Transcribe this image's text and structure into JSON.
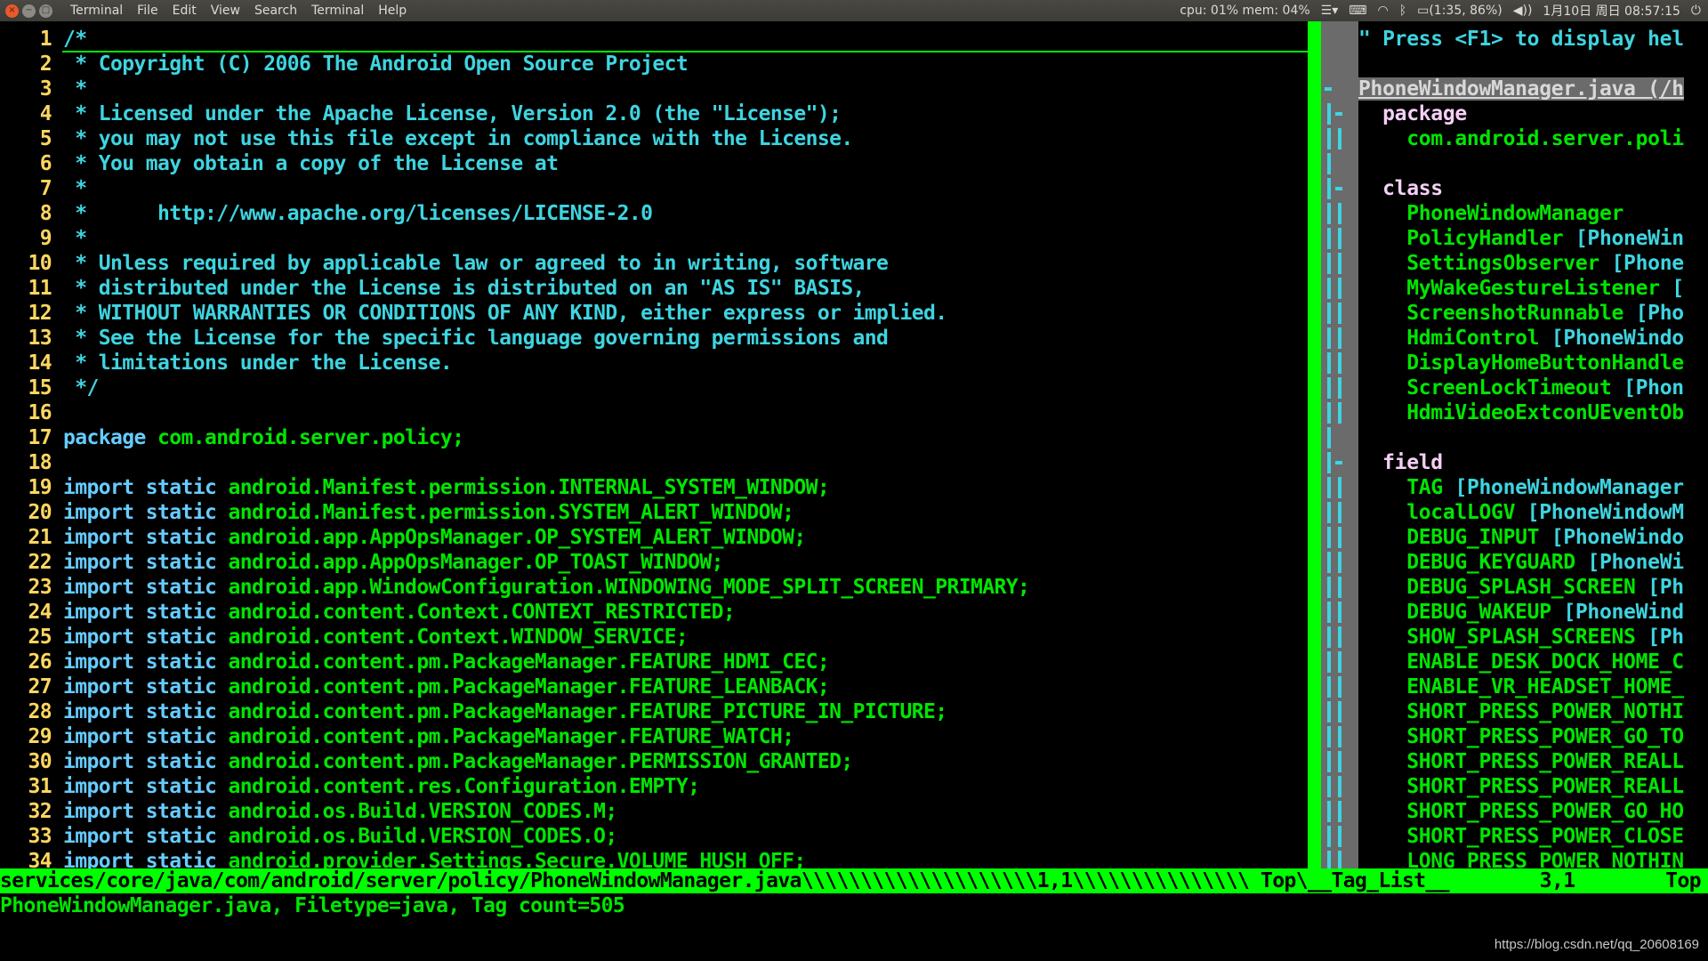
{
  "topbar": {
    "app_name": "Terminal",
    "menus": [
      "File",
      "Edit",
      "View",
      "Search",
      "Terminal",
      "Help"
    ],
    "window_buttons": {
      "close": "×",
      "minimize": "−",
      "maximize": "□"
    },
    "tray": {
      "sysmon": "cpu: 01% mem: 04%",
      "menu_icon": "☰▾",
      "keyboard_icon": "⌨",
      "wifi_icon": "◠",
      "bluetooth_icon": "ᛒ",
      "battery_icon": "▭",
      "battery": "(1:35, 86%)",
      "volume_icon": "◀))",
      "datetime": "1月10日 周日 08:57:15",
      "power_icon": "⏻"
    }
  },
  "editor": {
    "lines": [
      {
        "n": "1",
        "parts": [
          [
            "cmt",
            "/*"
          ]
        ]
      },
      {
        "n": "2",
        "parts": [
          [
            "cmt",
            " * Copyright (C) 2006 The Android Open Source Project"
          ]
        ]
      },
      {
        "n": "3",
        "parts": [
          [
            "cmt",
            " *"
          ]
        ]
      },
      {
        "n": "4",
        "parts": [
          [
            "cmt",
            " * Licensed under the Apache License, Version 2.0 (the \"License\");"
          ]
        ]
      },
      {
        "n": "5",
        "parts": [
          [
            "cmt",
            " * you may not use this file except in compliance with the License."
          ]
        ]
      },
      {
        "n": "6",
        "parts": [
          [
            "cmt",
            " * You may obtain a copy of the License at"
          ]
        ]
      },
      {
        "n": "7",
        "parts": [
          [
            "cmt",
            " *"
          ]
        ]
      },
      {
        "n": "8",
        "parts": [
          [
            "cmt",
            " *      http://www.apache.org/licenses/LICENSE-2.0"
          ]
        ]
      },
      {
        "n": "9",
        "parts": [
          [
            "cmt",
            " *"
          ]
        ]
      },
      {
        "n": "10",
        "parts": [
          [
            "cmt",
            " * Unless required by applicable law or agreed to in writing, software"
          ]
        ]
      },
      {
        "n": "11",
        "parts": [
          [
            "cmt",
            " * distributed under the License is distributed on an \"AS IS\" BASIS,"
          ]
        ]
      },
      {
        "n": "12",
        "parts": [
          [
            "cmt",
            " * WITHOUT WARRANTIES OR CONDITIONS OF ANY KIND, either express or implied."
          ]
        ]
      },
      {
        "n": "13",
        "parts": [
          [
            "cmt",
            " * See the License for the specific language governing permissions and"
          ]
        ]
      },
      {
        "n": "14",
        "parts": [
          [
            "cmt",
            " * limitations under the License."
          ]
        ]
      },
      {
        "n": "15",
        "parts": [
          [
            "cmt",
            " */"
          ]
        ]
      },
      {
        "n": "16",
        "parts": []
      },
      {
        "n": "17",
        "parts": [
          [
            "kw",
            "package "
          ],
          [
            "id",
            "com.android.server.policy;"
          ]
        ]
      },
      {
        "n": "18",
        "parts": []
      },
      {
        "n": "19",
        "parts": [
          [
            "kw",
            "import static "
          ],
          [
            "id",
            "android.Manifest.permission.INTERNAL_SYSTEM_WINDOW;"
          ]
        ]
      },
      {
        "n": "20",
        "parts": [
          [
            "kw",
            "import static "
          ],
          [
            "id",
            "android.Manifest.permission.SYSTEM_ALERT_WINDOW;"
          ]
        ]
      },
      {
        "n": "21",
        "parts": [
          [
            "kw",
            "import static "
          ],
          [
            "id",
            "android.app.AppOpsManager.OP_SYSTEM_ALERT_WINDOW;"
          ]
        ]
      },
      {
        "n": "22",
        "parts": [
          [
            "kw",
            "import static "
          ],
          [
            "id",
            "android.app.AppOpsManager.OP_TOAST_WINDOW;"
          ]
        ]
      },
      {
        "n": "23",
        "parts": [
          [
            "kw",
            "import static "
          ],
          [
            "id",
            "android.app.WindowConfiguration.WINDOWING_MODE_SPLIT_SCREEN_PRIMARY;"
          ]
        ]
      },
      {
        "n": "24",
        "parts": [
          [
            "kw",
            "import static "
          ],
          [
            "id",
            "android.content.Context.CONTEXT_RESTRICTED;"
          ]
        ]
      },
      {
        "n": "25",
        "parts": [
          [
            "kw",
            "import static "
          ],
          [
            "id",
            "android.content.Context.WINDOW_SERVICE;"
          ]
        ]
      },
      {
        "n": "26",
        "parts": [
          [
            "kw",
            "import static "
          ],
          [
            "id",
            "android.content.pm.PackageManager.FEATURE_HDMI_CEC;"
          ]
        ]
      },
      {
        "n": "27",
        "parts": [
          [
            "kw",
            "import static "
          ],
          [
            "id",
            "android.content.pm.PackageManager.FEATURE_LEANBACK;"
          ]
        ]
      },
      {
        "n": "28",
        "parts": [
          [
            "kw",
            "import static "
          ],
          [
            "id",
            "android.content.pm.PackageManager.FEATURE_PICTURE_IN_PICTURE;"
          ]
        ]
      },
      {
        "n": "29",
        "parts": [
          [
            "kw",
            "import static "
          ],
          [
            "id",
            "android.content.pm.PackageManager.FEATURE_WATCH;"
          ]
        ]
      },
      {
        "n": "30",
        "parts": [
          [
            "kw",
            "import static "
          ],
          [
            "id",
            "android.content.pm.PackageManager.PERMISSION_GRANTED;"
          ]
        ]
      },
      {
        "n": "31",
        "parts": [
          [
            "kw",
            "import static "
          ],
          [
            "id",
            "android.content.res.Configuration.EMPTY;"
          ]
        ]
      },
      {
        "n": "32",
        "parts": [
          [
            "kw",
            "import static "
          ],
          [
            "id",
            "android.os.Build.VERSION_CODES.M;"
          ]
        ]
      },
      {
        "n": "33",
        "parts": [
          [
            "kw",
            "import static "
          ],
          [
            "id",
            "android.os.Build.VERSION_CODES.O;"
          ]
        ]
      },
      {
        "n": "34",
        "parts": [
          [
            "kw",
            "import static "
          ],
          [
            "id",
            "android.provider.Settings.Secure.VOLUME_HUSH_OFF;"
          ]
        ]
      }
    ]
  },
  "taglist": {
    "lines": [
      [
        [
          "hint",
          "\" Press <F1> to display hel"
        ]
      ],
      [],
      [
        [
          "hdr",
          "PhoneWindowManager.java (/h"
        ]
      ],
      [
        [
          "kind",
          "  package"
        ]
      ],
      [
        [
          "tag",
          "    com.android.server.poli"
        ]
      ],
      [],
      [
        [
          "kind",
          "  class"
        ]
      ],
      [
        [
          "tag",
          "    PhoneWindowManager"
        ]
      ],
      [
        [
          "tag",
          "    PolicyHandler "
        ],
        [
          "scope",
          "[PhoneWin"
        ]
      ],
      [
        [
          "tag",
          "    SettingsObserver "
        ],
        [
          "scope",
          "[Phone"
        ]
      ],
      [
        [
          "tag",
          "    MyWakeGestureListener "
        ],
        [
          "scope",
          "["
        ]
      ],
      [
        [
          "tag",
          "    ScreenshotRunnable "
        ],
        [
          "scope",
          "[Pho"
        ]
      ],
      [
        [
          "tag",
          "    HdmiControl "
        ],
        [
          "scope",
          "[PhoneWindo"
        ]
      ],
      [
        [
          "tag",
          "    DisplayHomeButtonHandle"
        ]
      ],
      [
        [
          "tag",
          "    ScreenLockTimeout "
        ],
        [
          "scope",
          "[Phon"
        ]
      ],
      [
        [
          "tag",
          "    HdmiVideoExtconUEventOb"
        ]
      ],
      [],
      [
        [
          "kind",
          "  field"
        ]
      ],
      [
        [
          "tag",
          "    TAG "
        ],
        [
          "scope",
          "[PhoneWindowManager"
        ]
      ],
      [
        [
          "tag",
          "    localLOGV "
        ],
        [
          "scope",
          "[PhoneWindowM"
        ]
      ],
      [
        [
          "tag",
          "    DEBUG_INPUT "
        ],
        [
          "scope",
          "[PhoneWindo"
        ]
      ],
      [
        [
          "tag",
          "    DEBUG_KEYGUARD "
        ],
        [
          "scope",
          "[PhoneWi"
        ]
      ],
      [
        [
          "tag",
          "    DEBUG_SPLASH_SCREEN "
        ],
        [
          "scope",
          "[Ph"
        ]
      ],
      [
        [
          "tag",
          "    DEBUG_WAKEUP "
        ],
        [
          "scope",
          "[PhoneWind"
        ]
      ],
      [
        [
          "tag",
          "    SHOW_SPLASH_SCREENS "
        ],
        [
          "scope",
          "[Ph"
        ]
      ],
      [
        [
          "tag",
          "    ENABLE_DESK_DOCK_HOME_C"
        ]
      ],
      [
        [
          "tag",
          "    ENABLE_VR_HEADSET_HOME_"
        ]
      ],
      [
        [
          "tag",
          "    SHORT_PRESS_POWER_NOTHI"
        ]
      ],
      [
        [
          "tag",
          "    SHORT_PRESS_POWER_GO_TO"
        ]
      ],
      [
        [
          "tag",
          "    SHORT_PRESS_POWER_REALL"
        ]
      ],
      [
        [
          "tag",
          "    SHORT_PRESS_POWER_REALL"
        ]
      ],
      [
        [
          "tag",
          "    SHORT_PRESS_POWER_GO_HO"
        ]
      ],
      [
        [
          "tag",
          "    SHORT_PRESS_POWER_CLOSE"
        ]
      ],
      [
        [
          "tag",
          "    LONG_PRESS_POWER_NOTHIN"
        ]
      ]
    ]
  },
  "statusline": {
    "file_path": "services/core/java/com/android/server/policy/PhoneWindowManager.java",
    "fill_a": "\\\\\\\\\\\\\\\\\\\\\\\\\\\\\\\\\\\\\\\\",
    "position": "1,1",
    "fill_b": "\\\\\\\\\\\\\\\\\\\\\\\\\\\\\\",
    "scroll": "Top",
    "sep": "\\",
    "taglist_name": "__Tag_List__",
    "taglist_position": "3,1",
    "taglist_scroll": "Top"
  },
  "cmdline": "PhoneWindowManager.java, Filetype=java, Tag count=505",
  "watermark": "https://blog.csdn.net/qq_20608169",
  "colors": {
    "comment": "#3ed4e0",
    "keyword": "#66ccff",
    "identifier": "#00e600",
    "line_number": "#ffd75f",
    "statusline": "#00ff00",
    "fold_column": "#6b6b6b"
  }
}
